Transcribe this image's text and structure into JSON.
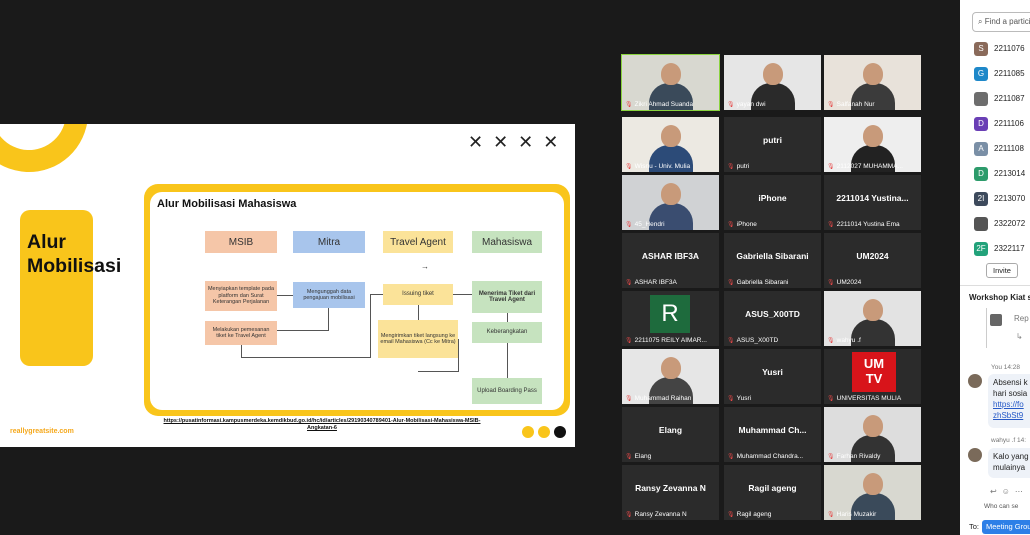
{
  "slide": {
    "big_title": "Alur\nMobilisasi",
    "xmarks": "✕✕✕✕",
    "inner_title": "Alur Mobilisasi Mahasiswa",
    "col_msib": "MSIB",
    "col_mitra": "Mitra",
    "col_travel": "Travel Agent",
    "col_maha": "Mahasiswa",
    "arrow": "→",
    "box1": "Menyiapkan template pada platform dan Surat Keterangan Perjalanan",
    "box2": "Mengunggah data pengajuan mobilisasi",
    "box3": "Issuing tiket",
    "box4": "Menerima Tiket dari Travel Agent",
    "box5": "Melakukan pemesanan tiket ke Travel Agent",
    "box6": "Mengirimkan tiket langsung ke email Mahasiswa (Cc ke Mitra)",
    "box7": "Keberangkatan",
    "box8": "Upload Boarding Pass",
    "link": "https://pusatinformasi.kampusmerdeka.kemdikbud.go.id/hc/id/articles/29190340789401-Alur-Mobilisasi-Mahasiswa-MSIB-Angkatan-6",
    "brand": "reallygreatsite.com",
    "colors": {
      "yellow": "#f9c51b",
      "dot_yellow": "#f9c51b",
      "dot_dark": "#111111"
    }
  },
  "tiles": [
    {
      "name": "Zikri Ahmad Suanda",
      "center": "",
      "type": "cam",
      "active": true
    },
    {
      "name": "yayan dwi",
      "center": "",
      "type": "cam"
    },
    {
      "name": "Salfanah Nur",
      "center": "",
      "type": "cam"
    },
    {
      "name": "Wisnu - Univ. Mulia",
      "center": "",
      "type": "cam"
    },
    {
      "name": "putri",
      "center": "putri",
      "type": "name"
    },
    {
      "name": "2112027 MUHAMMA...",
      "center": "",
      "type": "cam"
    },
    {
      "name": "45_Hendri",
      "center": "",
      "type": "cam"
    },
    {
      "name": "iPhone",
      "center": "iPhone",
      "type": "name"
    },
    {
      "name": "2211014 Yustina Ema",
      "center": "2211014 Yustina...",
      "type": "name"
    },
    {
      "name": "ASHAR IBF3A",
      "center": "ASHAR IBF3A",
      "type": "name"
    },
    {
      "name": "Gabriella Sibarani",
      "center": "Gabriella Sibarani",
      "type": "name"
    },
    {
      "name": "UM2024",
      "center": "UM2024",
      "type": "name"
    },
    {
      "name": "2211075 REILY AIMAR...",
      "center": "",
      "type": "R"
    },
    {
      "name": "ASUS_X00TD",
      "center": "ASUS_X00TD",
      "type": "name"
    },
    {
      "name": "wahyu .f",
      "center": "",
      "type": "cam"
    },
    {
      "name": "Muhammad Raihan",
      "center": "",
      "type": "cam"
    },
    {
      "name": "Yusri",
      "center": "Yusri",
      "type": "name"
    },
    {
      "name": "UNIVERSITAS MULIA",
      "center": "",
      "type": "UMTV"
    },
    {
      "name": "Elang",
      "center": "Elang",
      "type": "name"
    },
    {
      "name": "Muhammad Chandra...",
      "center": "Muhammad Ch...",
      "type": "name"
    },
    {
      "name": "Farhan Rivaldy",
      "center": "",
      "type": "cam"
    },
    {
      "name": "Ransy Zevanna N",
      "center": "Ransy Zevanna N",
      "type": "name"
    },
    {
      "name": "Ragil ageng",
      "center": "Ragil ageng",
      "type": "name"
    },
    {
      "name": "Haris Muzakir",
      "center": "",
      "type": "cam"
    }
  ],
  "panel": {
    "search_placeholder": "Find a partici",
    "participants": [
      {
        "initial": "S",
        "color": "#8a6a5a",
        "label": "2211076"
      },
      {
        "initial": "G",
        "color": "#1e88c9",
        "label": "2211085"
      },
      {
        "initial": "",
        "color": "#6d6d6d",
        "label": "2211087"
      },
      {
        "initial": "D",
        "color": "#6a3fb5",
        "label": "2211106"
      },
      {
        "initial": "A",
        "color": "#7a8fa6",
        "label": "2211108"
      },
      {
        "initial": "D",
        "color": "#2d9b6b",
        "label": "2213014"
      },
      {
        "initial": "2I",
        "color": "#3d4a5c",
        "label": "2213070"
      },
      {
        "initial": "",
        "color": "#555555",
        "label": "2322072"
      },
      {
        "initial": "2F",
        "color": "#22a27a",
        "label": "2322117"
      }
    ],
    "invite": "Invite",
    "chat_title": "Workshop Kiat s",
    "reply_label": "Rep",
    "msg1_meta": "You 14:28",
    "msg1_line1": "Absensi k",
    "msg1_line2": "hari sosia",
    "msg1_link1": "https://fo",
    "msg1_link2": "zhSbSt9",
    "msg2_meta": "wahyu .f 14:",
    "msg2_line1": "Kalo yang",
    "msg2_line2": "mulainya",
    "who_can": "Who can se",
    "to_label": "To:",
    "to_value": "Meeting Grou"
  }
}
